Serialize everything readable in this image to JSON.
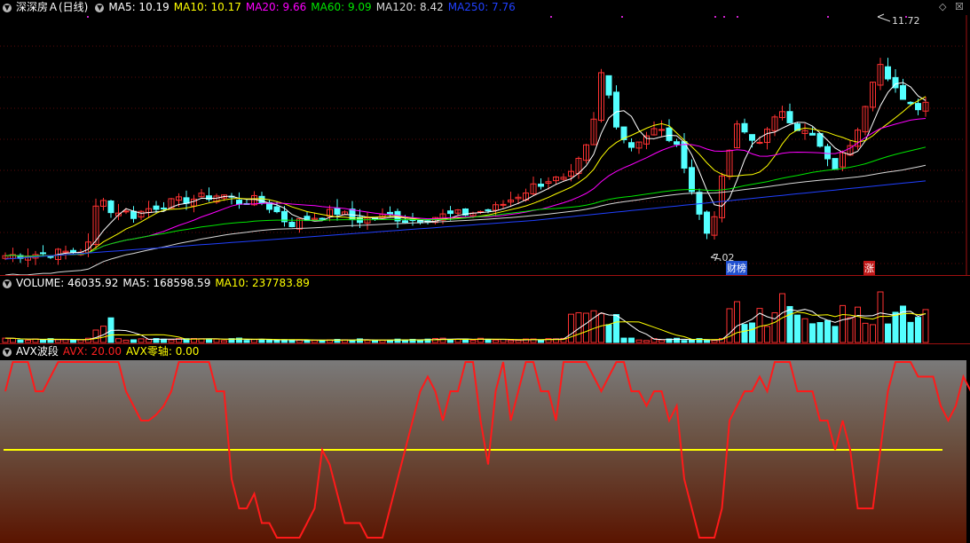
{
  "colors": {
    "up": "#ff3232",
    "down": "#54ffff",
    "ma5": "#ffffff",
    "ma10": "#ffff00",
    "ma20": "#ff00ff",
    "ma60": "#00e600",
    "ma120": "#d8d8d8",
    "ma250": "#2040ff",
    "avx": "#ff1a1a",
    "zero": "#ffff00",
    "title": "#ffffff",
    "sep": "#a01010"
  },
  "main": {
    "title": "深深房Ａ(日线)",
    "ma5": "MA5: 10.19",
    "ma10": "MA10: 10.17",
    "ma20": "MA20: 9.66",
    "ma60": "MA60: 9.09",
    "ma120": "MA120: 8.42",
    "ma250": "MA250: 7.76",
    "high_label": "11.72",
    "low_label": "7.02",
    "tag_finance": "财榜",
    "tag_rise": "涨",
    "diamond_icon": "diamond-icon",
    "close_icon": "close-icon"
  },
  "volume": {
    "label": "VOLUME: 46035.92",
    "ma5": "MA5: 168598.59",
    "ma10": "MA10: 237783.89"
  },
  "avx": {
    "title": "AVX波段",
    "avx": "AVX: 20.00",
    "zero": "AVX零轴: 0.00"
  },
  "chart_data": {
    "type": "candlestick",
    "price_range": [
      7.0,
      11.9
    ],
    "visible_extremes": {
      "high": 11.72,
      "low": 7.02
    },
    "avx_range": [
      -30,
      30
    ],
    "avx_values": [
      20,
      30,
      30,
      30,
      20,
      20,
      25,
      30,
      30,
      30,
      30,
      30,
      30,
      30,
      30,
      30,
      20,
      15,
      10,
      10,
      12,
      15,
      20,
      30,
      30,
      30,
      30,
      30,
      20,
      20,
      -10,
      -20,
      -20,
      -15,
      -25,
      -25,
      -30,
      -30,
      -30,
      -30,
      -25,
      -20,
      0,
      -5,
      -15,
      -25,
      -25,
      -25,
      -30,
      -30,
      -30,
      -20,
      -10,
      0,
      10,
      20,
      25,
      20,
      10,
      20,
      20,
      30,
      30,
      10,
      -5,
      20,
      30,
      10,
      20,
      30,
      30,
      20,
      20,
      10,
      30,
      30,
      30,
      30,
      25,
      20,
      25,
      30,
      30,
      20,
      20,
      15,
      20,
      20,
      10,
      15,
      -10,
      -20,
      -30,
      -30,
      -30,
      -20,
      10,
      15,
      20,
      20,
      25,
      20,
      30,
      30,
      30,
      20,
      20,
      20,
      10,
      10,
      0,
      10,
      0,
      -20,
      -20,
      -20,
      0,
      20,
      30,
      30,
      30,
      25,
      25,
      25,
      15,
      10,
      15,
      25,
      20
    ]
  }
}
